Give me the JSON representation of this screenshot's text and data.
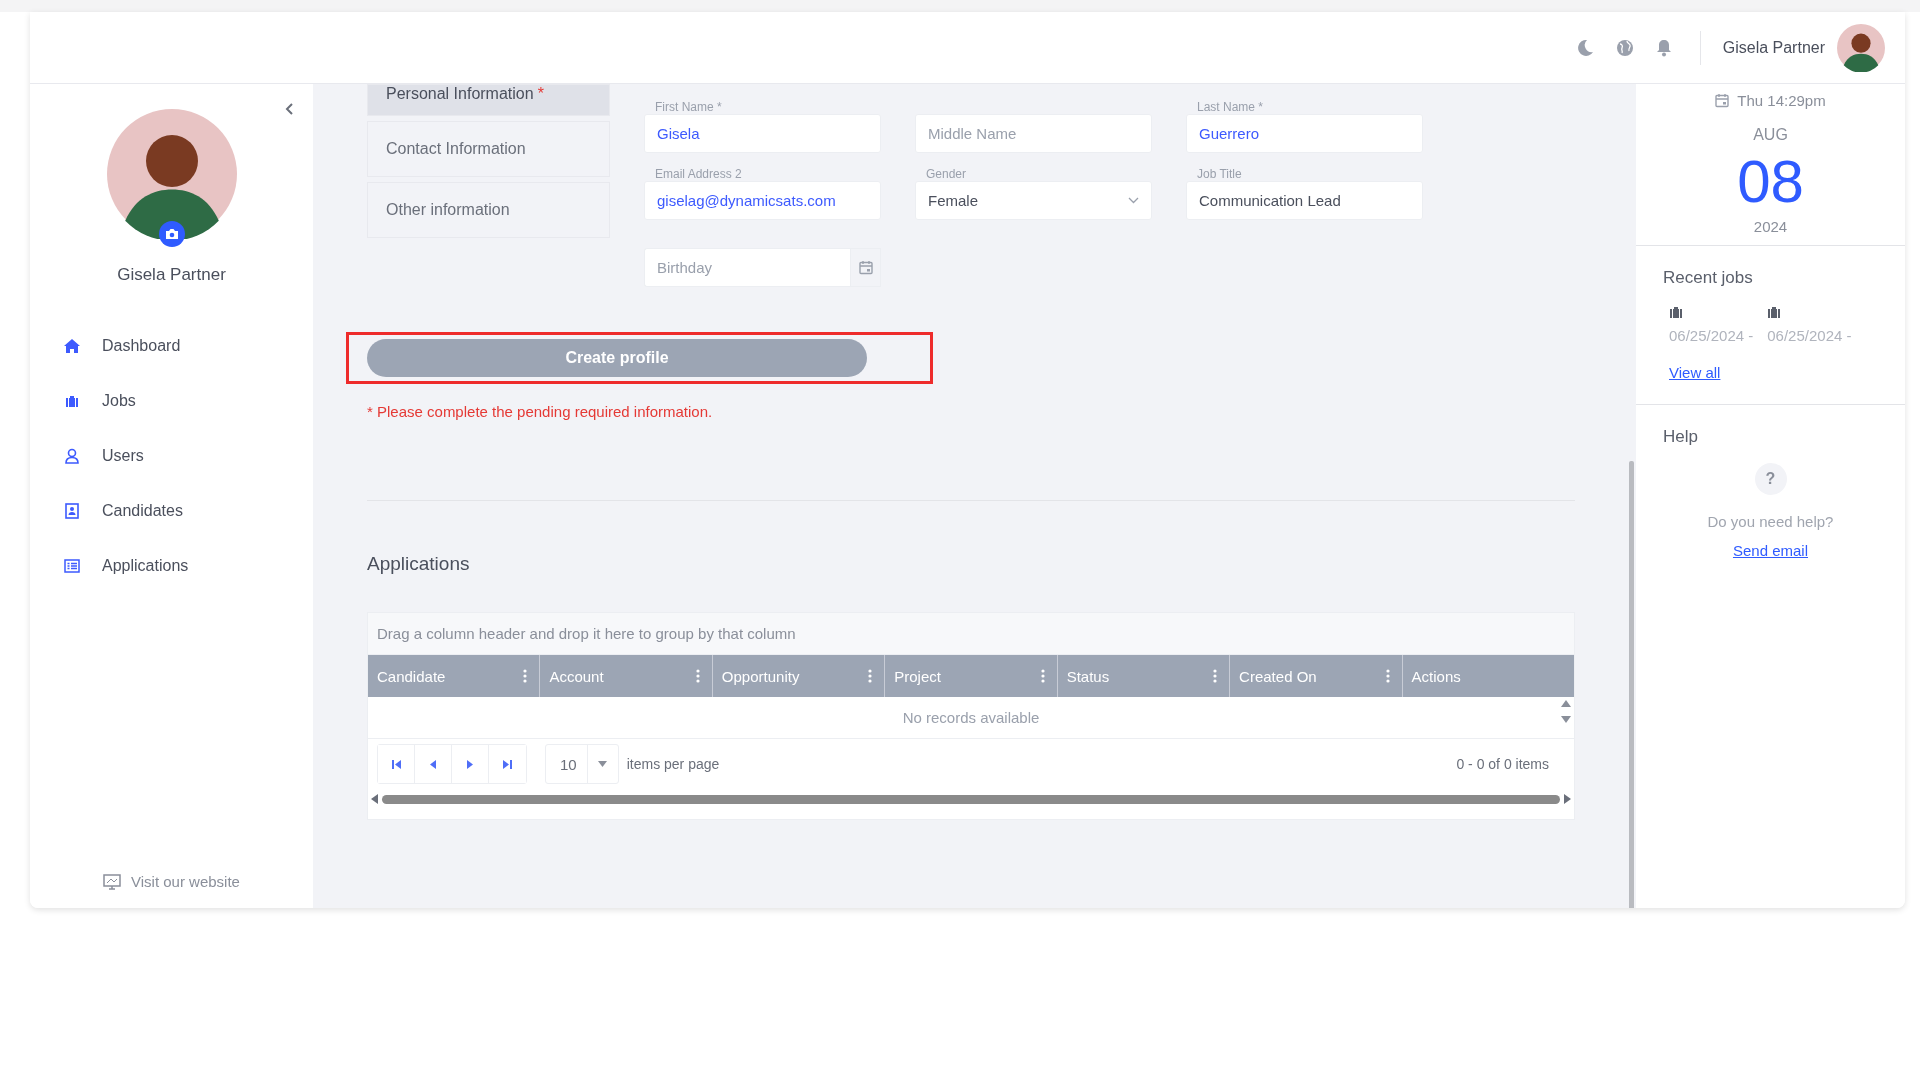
{
  "header": {
    "user_name": "Gisela Partner"
  },
  "sidebar": {
    "profile_name": "Gisela Partner",
    "items": [
      {
        "label": "Dashboard",
        "kind": "home"
      },
      {
        "label": "Jobs",
        "kind": "jobs"
      },
      {
        "label": "Users",
        "kind": "user"
      },
      {
        "label": "Candidates",
        "kind": "badge"
      },
      {
        "label": "Applications",
        "kind": "list"
      }
    ],
    "footer_link": "Visit our website"
  },
  "form": {
    "sections": [
      {
        "label": "Personal Information",
        "required_mark": "*",
        "selected": true
      },
      {
        "label": "Contact Information",
        "selected": false
      },
      {
        "label": "Other information",
        "selected": false
      }
    ],
    "fields": [
      {
        "kind": "text",
        "label": "First Name *",
        "value": "Gisela",
        "color": "#3d5afe"
      },
      {
        "kind": "text",
        "placeholder": "Middle Name"
      },
      {
        "kind": "text",
        "label": "Last Name *",
        "value": "Guerrero",
        "color": "#3d5afe"
      },
      {
        "kind": "text",
        "label": "Email Address 2",
        "value": "giselag@dynamicsats.com",
        "color": "#3d5afe"
      },
      {
        "kind": "select",
        "label": "Gender",
        "value": "Female",
        "color": "#4a4f5c"
      },
      {
        "kind": "text",
        "label": "Job Title",
        "value": "Communication Lead",
        "color": "#4a4f5c"
      },
      {
        "kind": "date",
        "placeholder": "Birthday"
      }
    ],
    "submit": {
      "label": "Create profile",
      "highlighted": true
    },
    "error": "* Please complete the pending required information."
  },
  "applications": {
    "title": "Applications",
    "group_hint": "Drag a column header and drop it here to group by that column",
    "columns": [
      {
        "label": "Candidate",
        "menu": true
      },
      {
        "label": "Account",
        "menu": true
      },
      {
        "label": "Opportunity",
        "menu": true
      },
      {
        "label": "Project",
        "menu": true
      },
      {
        "label": "Status",
        "menu": true
      },
      {
        "label": "Created On",
        "menu": true
      },
      {
        "label": "Actions",
        "menu": false
      }
    ],
    "empty": "No records available",
    "page_size": "10",
    "page_size_label": "items per page",
    "summary": "0 - 0 of 0 items"
  },
  "right_panel": {
    "date": {
      "weekday_time": "Thu 14:29pm",
      "month": "AUG",
      "day": "08",
      "year": "2024"
    },
    "recent_jobs": {
      "title": "Recent jobs",
      "items": [
        {
          "date": "06/25/2024 -"
        },
        {
          "date": "06/25/2024 -"
        }
      ],
      "link": "View all"
    },
    "help": {
      "title": "Help",
      "icon": "?",
      "text": "Do you need help?",
      "link": "Send email"
    }
  }
}
